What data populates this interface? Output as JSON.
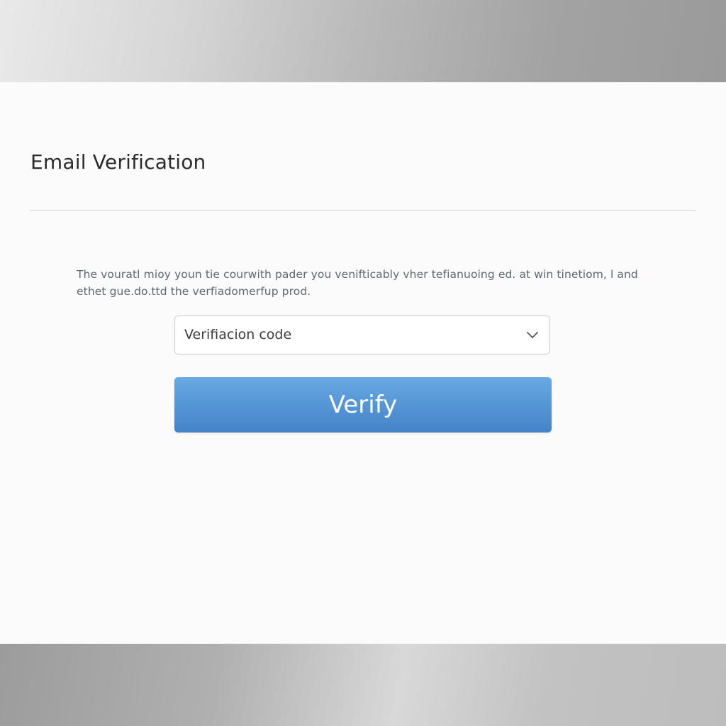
{
  "header": {
    "title": "Email Verification"
  },
  "body": {
    "instructions": "The vouratl mioy youn tie courwith pader you venifticably vher tefianuoing ed. at win tinetiom, l and ethet gue.do.ttd the verfiadomerfup prod."
  },
  "form": {
    "code_select": {
      "selected_value": "Verifiacion code",
      "icon": "chevron-down-icon"
    },
    "verify_label": "Verify"
  },
  "colors": {
    "accent": "#5596d6",
    "panel_background": "#fbfbfb",
    "title_text": "#2b2b2b"
  }
}
